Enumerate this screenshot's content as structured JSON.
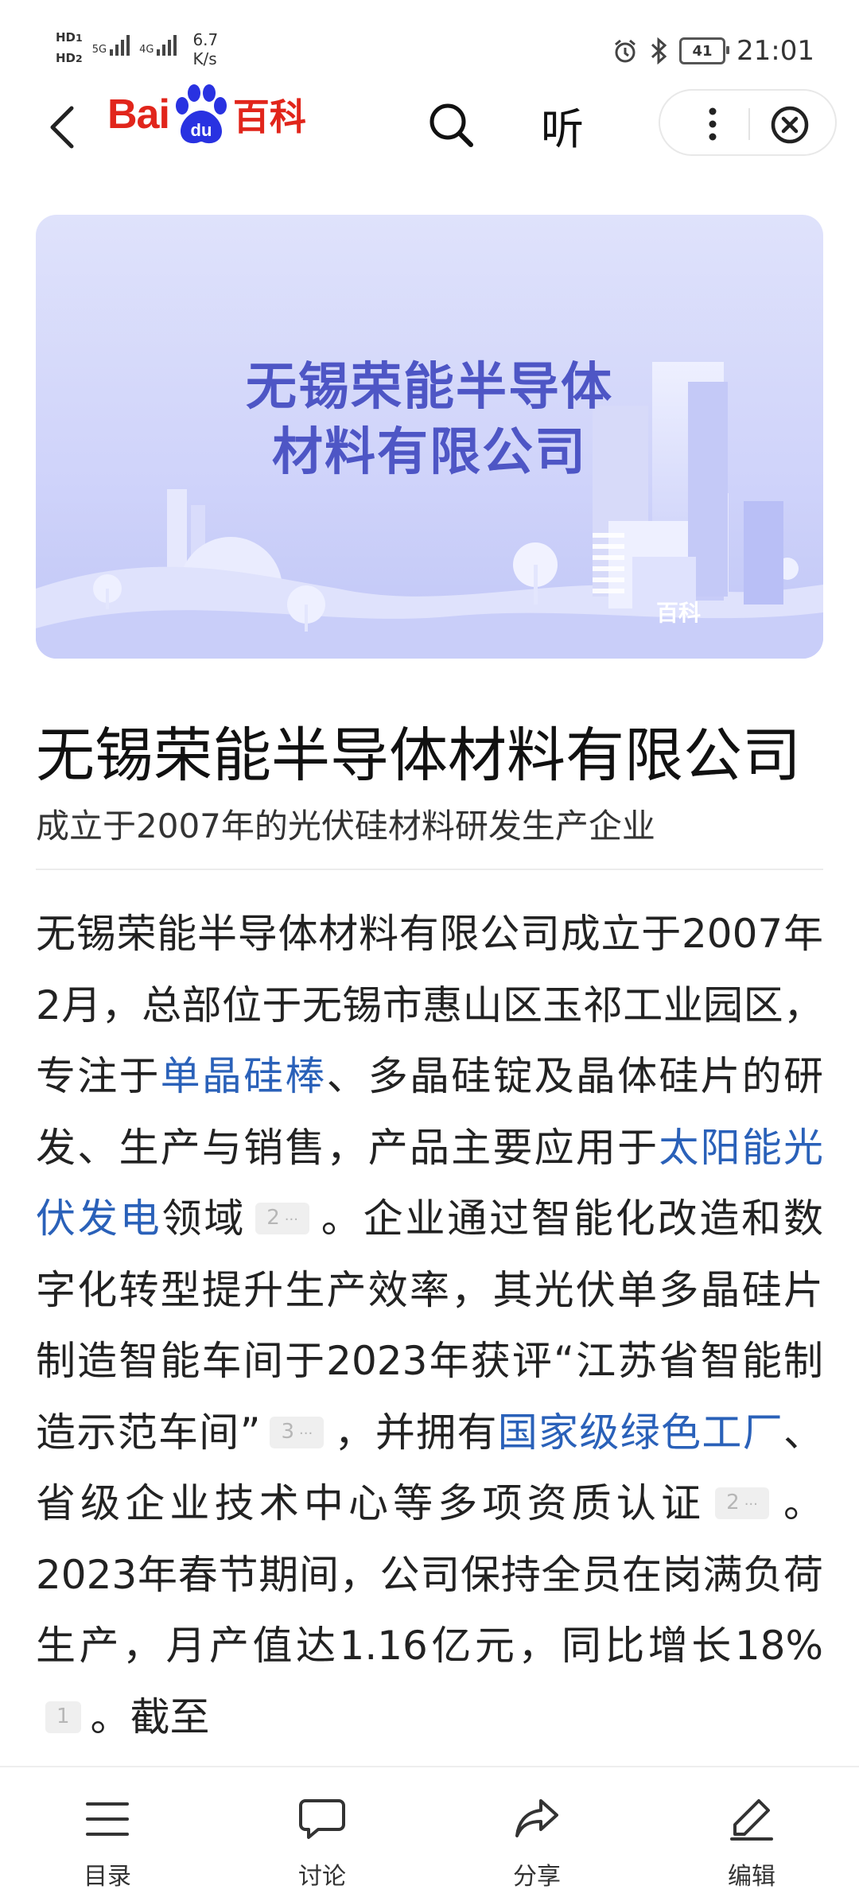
{
  "status_bar": {
    "hd1": "HD",
    "hd1_sub": "1",
    "hd2": "HD",
    "hd2_sub": "2",
    "sig1": "5G",
    "sig2": "4G",
    "speed_value": "6.7",
    "speed_unit": "K/s",
    "battery": "41",
    "time": "21:01"
  },
  "nav": {
    "logo_text_bai": "Bai",
    "logo_text_du": "du",
    "logo_text_baike": "百科",
    "listen_label": "听"
  },
  "banner": {
    "line1": "无锡荣能半导体",
    "line2": "材料有限公司",
    "watermark": "百科"
  },
  "article": {
    "title": "无锡荣能半导体材料有限公司",
    "subtitle": "成立于2007年的光伏硅材料研发生产企业",
    "p1": "无锡荣能半导体材料有限公司成立于2007年2月，总部位于无锡市惠山区玉祁工业园区，专注于",
    "link1": "单晶硅棒",
    "p2": "、多晶硅锭及晶体硅片的研发、生产与销售，产品主要应用于",
    "link2": "太阳能光伏发电",
    "p3": "领域",
    "ref1": "2",
    "p4": "。企业通过智能化改造和数字化转型提升生产效率，其光伏单多晶硅片制造智能车间于2023年获评“江苏省智能制造示范车间”",
    "ref2": "3",
    "p5": "，并拥有",
    "link3": "国家级绿色工厂",
    "p6": "、省级企业技术中心等多项资质认证",
    "ref3": "2",
    "p7": "。2023年春节期间，公司保持全员在岗满负荷生产，月产值达1.16亿元，同比增长18%",
    "ref4": "1",
    "p8": "。截至",
    "ref_dots": "···"
  },
  "bottom_bar": {
    "toc": "目录",
    "discuss": "讨论",
    "share": "分享",
    "edit": "编辑"
  }
}
